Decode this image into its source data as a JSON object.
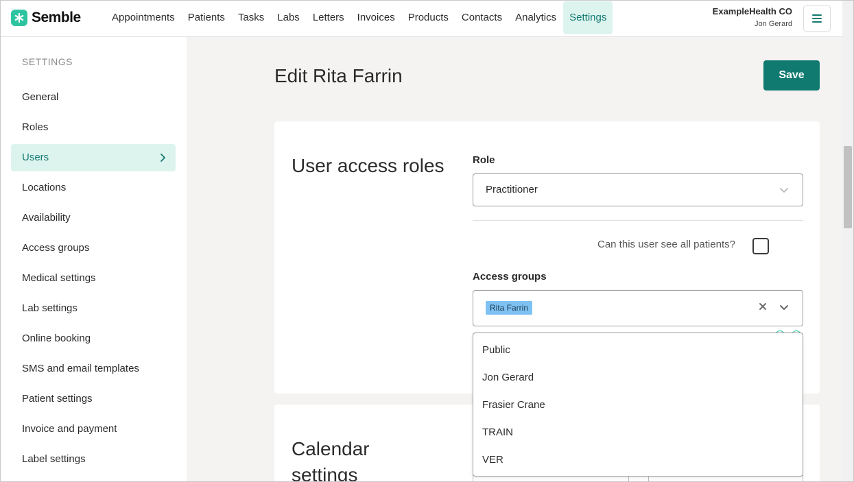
{
  "app": {
    "brand": "Semble",
    "nav": [
      "Appointments",
      "Patients",
      "Tasks",
      "Labs",
      "Letters",
      "Invoices",
      "Products",
      "Contacts",
      "Analytics",
      "Settings"
    ],
    "active_nav": "Settings",
    "org_name": "ExampleHealth CO",
    "user_name": "Jon Gerard"
  },
  "sidebar": {
    "heading": "SETTINGS",
    "items": [
      "General",
      "Roles",
      "Users",
      "Locations",
      "Availability",
      "Access groups",
      "Medical settings",
      "Lab settings",
      "Online booking",
      "SMS and email templates",
      "Patient settings",
      "Invoice and payment",
      "Label settings"
    ],
    "active_item": "Users"
  },
  "main": {
    "title": "Edit Rita Farrin",
    "save_label": "Save",
    "access_card": {
      "title": "User access roles",
      "role_label": "Role",
      "role_value": "Practitioner",
      "see_all_question": "Can this user see all patients?",
      "see_all_checked": false,
      "groups_label": "Access groups",
      "selected_groups": [
        "Rita Farrin"
      ],
      "dropdown_options": [
        "Public",
        "Jon Gerard",
        "Frasier Crane",
        "TRAIN",
        "VER"
      ]
    },
    "calendar_card": {
      "title_line1": "Calendar",
      "title_line2": "settings"
    }
  },
  "colors": {
    "accent": "#117a70",
    "accent_light": "#ddf3ee",
    "brand_green": "#2ec4a0",
    "tag_blue": "#7ec2f3"
  },
  "icons": {
    "logo": "semble-logo-icon",
    "menu": "hamburger-menu-icon",
    "sidebar_active": "chevron-right-icon",
    "select": "chevron-down-icon",
    "clear": "close-icon"
  }
}
